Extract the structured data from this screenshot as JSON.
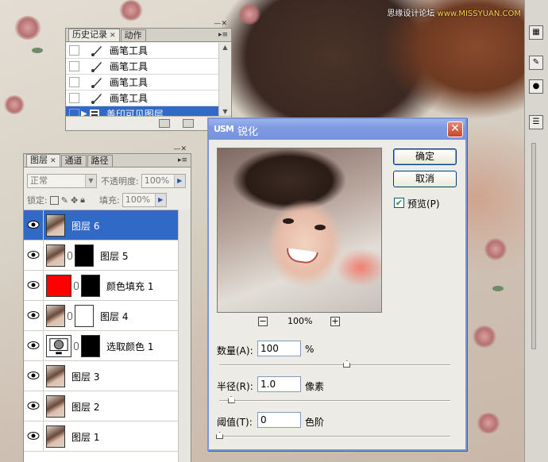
{
  "watermark": {
    "site": "思缘设计论坛",
    "url": "www.MISSYUAN.COM"
  },
  "history_panel": {
    "tabs": [
      {
        "label": "历史记录"
      },
      {
        "label": "动作"
      }
    ],
    "rows": [
      {
        "label": "画笔工具"
      },
      {
        "label": "画笔工具"
      },
      {
        "label": "画笔工具"
      },
      {
        "label": "画笔工具"
      },
      {
        "label": "盖印可见图层"
      }
    ],
    "selected_index": 4
  },
  "layers_panel": {
    "tabs": [
      {
        "label": "图层"
      },
      {
        "label": "通道"
      },
      {
        "label": "路径"
      }
    ],
    "blend_mode": "正常",
    "opacity_label": "不透明度:",
    "opacity_value": "100%",
    "lock_label": "锁定:",
    "fill_label": "填充:",
    "fill_value": "100%",
    "layers": [
      {
        "name": "图层 6"
      },
      {
        "name": "图层 5"
      },
      {
        "name": "颜色填充 1"
      },
      {
        "name": "图层 4"
      },
      {
        "name": "选取颜色 1"
      },
      {
        "name": "图层 3"
      },
      {
        "name": "图层 2"
      },
      {
        "name": "图层 1"
      }
    ],
    "selected_index": 0
  },
  "usm_dialog": {
    "icon_text": "USM",
    "title": "锐化",
    "ok_label": "确定",
    "cancel_label": "取消",
    "preview_label": "预览(P)",
    "preview_checked": true,
    "zoom": "100%",
    "amount": {
      "label": "数量(A):",
      "value": "100",
      "unit": "%",
      "slider_fraction": 0.55
    },
    "radius": {
      "label": "半径(R):",
      "value": "1.0",
      "unit": "像素",
      "slider_fraction": 0.05
    },
    "threshold": {
      "label": "阈值(T):",
      "value": "0",
      "unit": "色阶",
      "slider_fraction": 0.0
    }
  }
}
